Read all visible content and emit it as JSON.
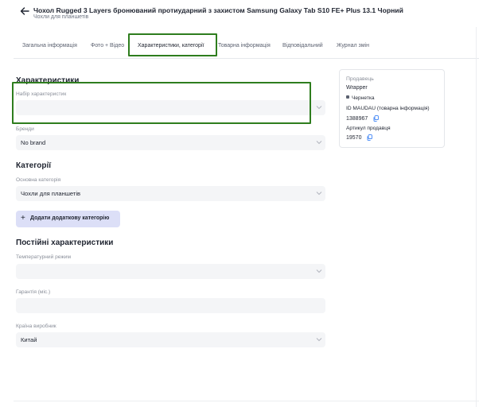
{
  "header": {
    "title": "Чохол Rugged 3 Layers бронюваний протиударний з захистом Samsung Galaxy Tab S10 FE+ Plus 13.1 Чорний",
    "subtitle": "Чохли для планшетів"
  },
  "tabs": [
    {
      "label": "Загальна інформація"
    },
    {
      "label": "Фото + Відео"
    },
    {
      "label": "Характеристики, категорії"
    },
    {
      "label": "Товарна інформація"
    },
    {
      "label": "Відповідальний"
    },
    {
      "label": "Журнал змін"
    }
  ],
  "active_tab": "Характеристики, категорії",
  "characteristics": {
    "title": "Характеристики",
    "set_label": "Набір характеристик",
    "set_value": "",
    "brand_label": "Бренди",
    "brand_value": "No brand"
  },
  "categories": {
    "title": "Категорії",
    "main_label": "Основна категорія",
    "main_value": "Чохли для планшетів",
    "add_button": "Додати додаткову категорію"
  },
  "permanent": {
    "title": "Постійні характеристики",
    "temp_label": "Температурний режим",
    "temp_value": "",
    "warranty_label": "Гарантія (міс.)",
    "warranty_value": "",
    "country_label": "Країна виробник",
    "country_value": "Китай"
  },
  "seller_card": {
    "seller_label": "Продавець",
    "seller_value": "Wrapper",
    "status": "Чернетка",
    "id_label": "ID MAUDAU (товарна інформація)",
    "id_value": "1388967",
    "article_label": "Артикул продавця",
    "article_value": "19570"
  },
  "colors": {
    "highlight": "#2e7d1e",
    "field_bg": "#f4f5f7",
    "add_button_bg": "#dcdff7",
    "copy_icon": "#3b82f6"
  }
}
